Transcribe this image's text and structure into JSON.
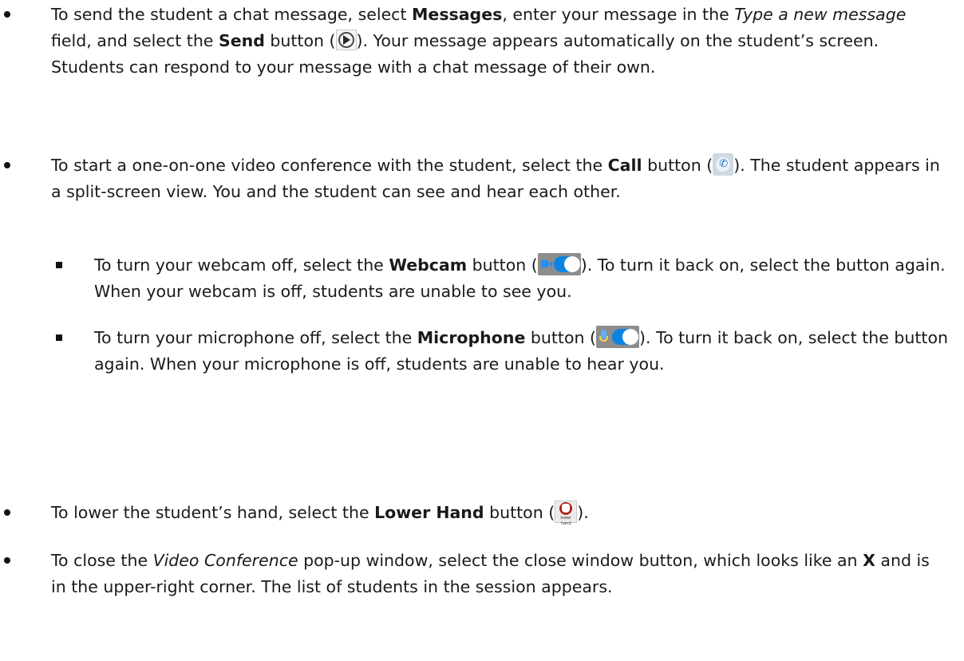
{
  "items": [
    {
      "t1": "To send the student a chat message, select ",
      "b1": "Messages",
      "t2": ", enter your message in the ",
      "i1": "Type a new message",
      "t3": " field, and select the ",
      "b2": "Send",
      "t4": " button (",
      "t5": "). Your message appears automatically on the student’s screen. Students can respond to your message with a chat message of their own."
    },
    {
      "t1": "To start a one-on-one video conference with the student, select the ",
      "b1": "Call",
      "t2": " button (",
      "t3": "). The student appears in a split-screen view. You and the student can see and hear each other."
    },
    {
      "t1": "To turn your webcam off, select the ",
      "b1": "Webcam",
      "t2": " button (",
      "t3": "). To turn it back on, select the button again. When your webcam is off, students are unable to see you."
    },
    {
      "t1": "To turn your microphone off, select the ",
      "b1": "Microphone",
      "t2": " button (",
      "t3": "). To turn it back on, select the button again. When your microphone is off, students are unable to hear you."
    },
    {
      "t1": "To lower the student’s hand, select the ",
      "b1": "Lower Hand",
      "t2": " button (",
      "t3": ")."
    },
    {
      "t1": "To close the ",
      "i1": "Video Conference",
      "t2": " pop-up window, select the close window button, which looks like an ",
      "b1": "X",
      "t3": " and is in the upper-right corner. The list of students in the session appears."
    }
  ],
  "icons": {
    "send": "send-arrow-icon",
    "call": "phone-icon",
    "webcam": "webcam-toggle-icon",
    "microphone": "microphone-toggle-icon",
    "lower_hand": "raised-hand-icon",
    "lower_hand_caption": "lower hand"
  },
  "colors": {
    "toggle_blue": "#0a84e0",
    "hand_red": "#b0201c"
  }
}
